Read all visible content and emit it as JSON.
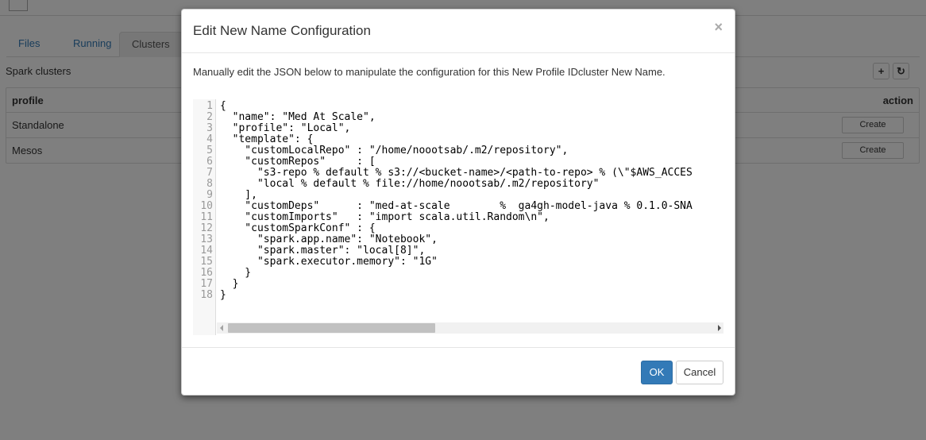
{
  "tabs": [
    {
      "label": "Files"
    },
    {
      "label": "Running"
    },
    {
      "label": "Clusters"
    }
  ],
  "clusters": {
    "section_title": "Spark clusters",
    "add_icon": "plus-icon",
    "refresh_icon": "refresh-icon",
    "columns": {
      "profile": "profile",
      "action": "action"
    },
    "rows": [
      {
        "profile": "Standalone",
        "action": "Create"
      },
      {
        "profile": "Mesos",
        "action": "Create"
      }
    ]
  },
  "modal": {
    "title": "Edit New Name Configuration",
    "close_label": "×",
    "description": "Manually edit the JSON below to manipulate the configuration for this New Profile IDcluster New Name.",
    "line_numbers": [
      "1",
      "2",
      "3",
      "4",
      "5",
      "6",
      "7",
      "8",
      "9",
      "10",
      "11",
      "12",
      "13",
      "14",
      "15",
      "16",
      "17",
      "18"
    ],
    "code_lines": [
      "{",
      "  \"name\": \"Med At Scale\",",
      "  \"profile\": \"Local\",",
      "  \"template\": {",
      "    \"customLocalRepo\" : \"/home/noootsab/.m2/repository\",",
      "    \"customRepos\"     : [",
      "      \"s3-repo % default % s3://<bucket-name>/<path-to-repo> % (\\\"$AWS_ACCES",
      "      \"local % default % file://home/noootsab/.m2/repository\"",
      "    ],",
      "    \"customDeps\"      : \"med-at-scale        %  ga4gh-model-java % 0.1.0-SNA",
      "    \"customImports\"   : \"import scala.util.Random\\n\",",
      "    \"customSparkConf\" : {",
      "      \"spark.app.name\": \"Notebook\",",
      "      \"spark.master\": \"local[8]\",",
      "      \"spark.executor.memory\": \"1G\"",
      "    }",
      "  }",
      "}"
    ],
    "ok_label": "OK",
    "cancel_label": "Cancel"
  },
  "colors": {
    "primary": "#337ab7",
    "link": "#337ab7",
    "backdrop": "rgba(0,0,0,0.5)"
  }
}
